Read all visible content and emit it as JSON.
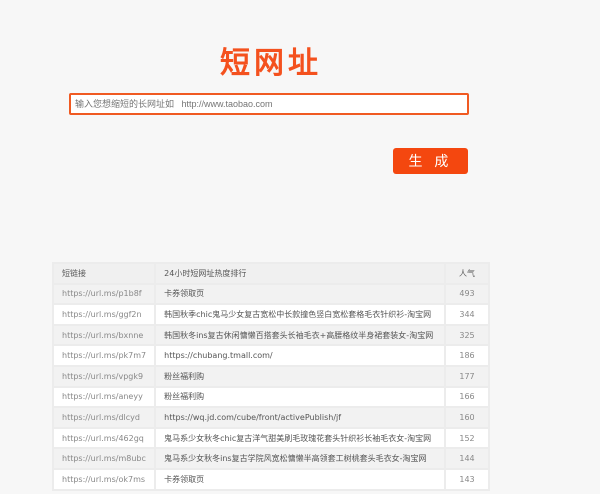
{
  "title": "短网址",
  "input": {
    "placeholder": "输入您想缩短的长网址如   http://www.taobao.com",
    "value": ""
  },
  "generate_label": "生 成",
  "table": {
    "headers": [
      "短链接",
      "24小时短网址热度排行",
      "人气"
    ],
    "rows": [
      [
        "https://url.ms/p1b8f",
        "卡券领取页",
        "493"
      ],
      [
        "https://url.ms/ggf2n",
        "韩国秋季chic鬼马少女复古宽松中长款撞色竖白宽松套格毛衣针织衫-淘宝网",
        "344"
      ],
      [
        "https://url.ms/bxnne",
        "韩国秋冬ins复古休闲慵懒百搭套头长袖毛衣+高腰格纹半身裙套装女-淘宝网",
        "325"
      ],
      [
        "https://url.ms/pk7m7",
        "https://chubang.tmall.com/",
        "186"
      ],
      [
        "https://url.ms/vpgk9",
        "粉丝福利购",
        "177"
      ],
      [
        "https://url.ms/aneyy",
        "粉丝福利购",
        "166"
      ],
      [
        "https://url.ms/dlcyd",
        "https://wq.jd.com/cube/front/activePublish/jf",
        "160"
      ],
      [
        "https://url.ms/462gq",
        "鬼马系少女秋冬chic复古洋气甜美刷毛玫瑰花套头针织衫长袖毛衣女-淘宝网",
        "152"
      ],
      [
        "https://url.ms/m8ubc",
        "鬼马系少女秋冬ins复古学院风宽松慵懒半高领套工树桃套头毛衣女-淘宝网",
        "144"
      ],
      [
        "https://url.ms/ok7ms",
        "卡券领取页",
        "143"
      ]
    ]
  }
}
